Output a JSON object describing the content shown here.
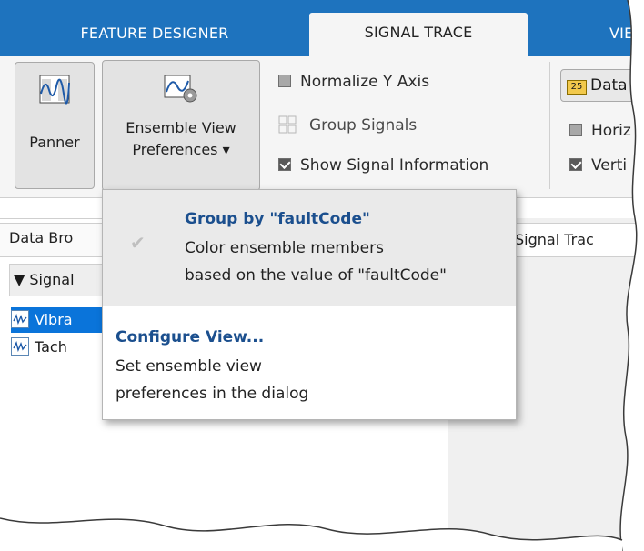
{
  "tabs": [
    {
      "label": "FEATURE DESIGNER"
    },
    {
      "label": "SIGNAL TRACE"
    },
    {
      "label": "VIE"
    }
  ],
  "ribbon": {
    "panner_label": "Panner",
    "ensemble_line1": "Ensemble View",
    "ensemble_line2": "Preferences ▾",
    "normalize": "Normalize Y Axis",
    "group": "Group Signals",
    "show_info": "Show Signal Information",
    "data_btn": "Data",
    "horiz": "Horiz",
    "verti": "Verti"
  },
  "left_panel": {
    "header": "Data Bro",
    "tree_head": "▼ Signal",
    "rows": [
      "Vibra",
      "Tach"
    ]
  },
  "right_panel": {
    "header": "Signal Trac"
  },
  "popup": {
    "item1_title": "Group by \"faultCode\"",
    "item1_line1": "Color ensemble members",
    "item1_line2": "based on the value of \"faultCode\"",
    "item2_title": "Configure View...",
    "item2_line1": "Set ensemble view",
    "item2_line2": "preferences in the dialog"
  },
  "colors": {
    "tab_strip": "#1e73be",
    "selection": "#0a74da",
    "menu_title": "#1b4f8e"
  }
}
